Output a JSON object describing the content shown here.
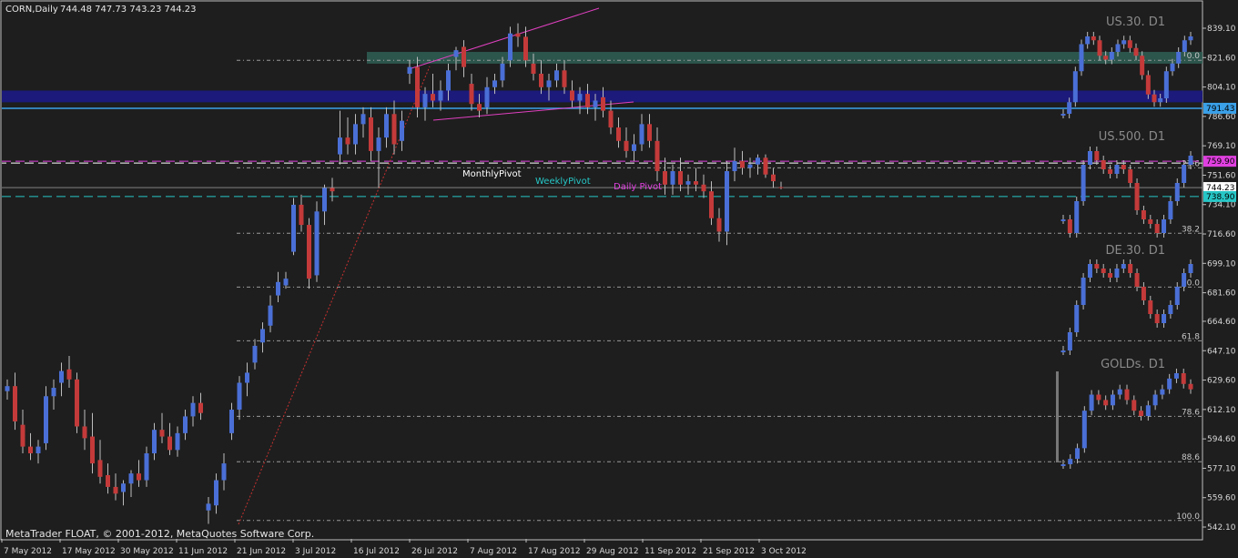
{
  "header": {
    "symbol_label": "CORN,Daily",
    "ohlc_text": "744.48 747.73 743.23 744.23"
  },
  "footer": {
    "copyright": "MetaTrader FLOAT, © 2001-2012, MetaQuotes Software Corp."
  },
  "colors": {
    "background": "#1e1e1e",
    "bull_candle": "#4a6fd6",
    "bear_candle": "#c43a3a",
    "fib_band": "#2f5f55",
    "blue_band": "#1c1a7a",
    "monthly_pivot": "#ffffff",
    "weekly_pivot": "#27c6c6",
    "daily_pivot": "#e040e0",
    "resistance_line": "#3aa0e8"
  },
  "chart_data": {
    "type": "candlestick",
    "symbol": "CORN",
    "timeframe": "Daily",
    "ylim": [
      542.1,
      850
    ],
    "y_ticks": [
      "839.10",
      "821.60",
      "804.10",
      "786.60",
      "769.10",
      "751.60",
      "734.10",
      "716.60",
      "699.10",
      "681.60",
      "664.60",
      "647.10",
      "629.60",
      "612.10",
      "594.60",
      "577.10",
      "559.60",
      "542.10"
    ],
    "x_ticks": [
      "7 May 2012",
      "17 May 2012",
      "30 May 2012",
      "11 Jun 2012",
      "21 Jun 2012",
      "3 Jul 2012",
      "16 Jul 2012",
      "26 Jul 2012",
      "7 Aug 2012",
      "17 Aug 2012",
      "29 Aug 2012",
      "11 Sep 2012",
      "21 Sep 2012",
      "3 Oct 2012"
    ],
    "price_tags": [
      {
        "value": 791.43,
        "label": "791.43",
        "color": "#3aa0e8"
      },
      {
        "value": 759.9,
        "label": "759.90",
        "color": "#e040e0"
      },
      {
        "value": 744.23,
        "label": "744.23",
        "color": "#ffffff"
      },
      {
        "value": 738.9,
        "label": "738.90",
        "color": "#27c6c6"
      }
    ],
    "fib_levels": [
      {
        "label": "0.0",
        "value": 820
      },
      {
        "label": "23.6",
        "value": 756
      },
      {
        "label": "38.2",
        "value": 717
      },
      {
        "label": "50.0",
        "value": 685
      },
      {
        "label": "61.8",
        "value": 653
      },
      {
        "label": "78.6",
        "value": 608
      },
      {
        "label": "88.6",
        "value": 581
      },
      {
        "label": "100.0",
        "value": 546
      }
    ],
    "pivots": [
      {
        "name": "MonthlyPivot",
        "value": 759.9
      },
      {
        "name": "WeeklyPivot",
        "value": 738.9
      },
      {
        "name": "Daily Pivot",
        "value": 759.9
      }
    ],
    "bands": [
      {
        "name": "fib_zone",
        "from": 818,
        "to": 825
      },
      {
        "name": "blue_zone",
        "from": 795,
        "to": 802
      }
    ],
    "candles": [
      {
        "o": 623,
        "h": 630,
        "l": 618,
        "c": 626
      },
      {
        "o": 626,
        "h": 634,
        "l": 600,
        "c": 605
      },
      {
        "o": 603,
        "h": 612,
        "l": 586,
        "c": 590
      },
      {
        "o": 590,
        "h": 598,
        "l": 582,
        "c": 586
      },
      {
        "o": 586,
        "h": 594,
        "l": 580,
        "c": 590
      },
      {
        "o": 592,
        "h": 626,
        "l": 588,
        "c": 620
      },
      {
        "o": 620,
        "h": 630,
        "l": 612,
        "c": 625
      },
      {
        "o": 628,
        "h": 640,
        "l": 620,
        "c": 635
      },
      {
        "o": 636,
        "h": 644,
        "l": 625,
        "c": 630
      },
      {
        "o": 630,
        "h": 634,
        "l": 598,
        "c": 602
      },
      {
        "o": 602,
        "h": 612,
        "l": 588,
        "c": 595
      },
      {
        "o": 596,
        "h": 610,
        "l": 574,
        "c": 580
      },
      {
        "o": 582,
        "h": 594,
        "l": 568,
        "c": 572
      },
      {
        "o": 573,
        "h": 580,
        "l": 562,
        "c": 566
      },
      {
        "o": 566,
        "h": 574,
        "l": 558,
        "c": 562
      },
      {
        "o": 563,
        "h": 570,
        "l": 555,
        "c": 568
      },
      {
        "o": 568,
        "h": 576,
        "l": 560,
        "c": 574
      },
      {
        "o": 574,
        "h": 582,
        "l": 566,
        "c": 570
      },
      {
        "o": 570,
        "h": 590,
        "l": 566,
        "c": 586
      },
      {
        "o": 586,
        "h": 604,
        "l": 582,
        "c": 600
      },
      {
        "o": 600,
        "h": 610,
        "l": 592,
        "c": 596
      },
      {
        "o": 596,
        "h": 604,
        "l": 585,
        "c": 588
      },
      {
        "o": 588,
        "h": 602,
        "l": 584,
        "c": 598
      },
      {
        "o": 598,
        "h": 612,
        "l": 594,
        "c": 608
      },
      {
        "o": 608,
        "h": 620,
        "l": 602,
        "c": 616
      },
      {
        "o": 616,
        "h": 622,
        "l": 606,
        "c": 610
      },
      {
        "o": 552,
        "h": 560,
        "l": 544,
        "c": 556
      },
      {
        "o": 555,
        "h": 574,
        "l": 550,
        "c": 570
      },
      {
        "o": 570,
        "h": 586,
        "l": 564,
        "c": 580
      },
      {
        "o": 598,
        "h": 616,
        "l": 594,
        "c": 612
      },
      {
        "o": 612,
        "h": 632,
        "l": 606,
        "c": 628
      },
      {
        "o": 628,
        "h": 640,
        "l": 620,
        "c": 634
      },
      {
        "o": 640,
        "h": 654,
        "l": 636,
        "c": 650
      },
      {
        "o": 652,
        "h": 664,
        "l": 646,
        "c": 660
      },
      {
        "o": 662,
        "h": 680,
        "l": 658,
        "c": 674
      },
      {
        "o": 680,
        "h": 694,
        "l": 676,
        "c": 688
      },
      {
        "o": 686,
        "h": 694,
        "l": 684,
        "c": 690
      },
      {
        "o": 706,
        "h": 738,
        "l": 704,
        "c": 734
      },
      {
        "o": 734,
        "h": 740,
        "l": 718,
        "c": 722
      },
      {
        "o": 722,
        "h": 726,
        "l": 684,
        "c": 690
      },
      {
        "o": 692,
        "h": 736,
        "l": 688,
        "c": 730
      },
      {
        "o": 730,
        "h": 746,
        "l": 722,
        "c": 744
      },
      {
        "o": 744,
        "h": 750,
        "l": 736,
        "c": 742
      },
      {
        "o": 764,
        "h": 790,
        "l": 758,
        "c": 774
      },
      {
        "o": 774,
        "h": 786,
        "l": 764,
        "c": 770
      },
      {
        "o": 770,
        "h": 788,
        "l": 764,
        "c": 782
      },
      {
        "o": 782,
        "h": 792,
        "l": 774,
        "c": 788
      },
      {
        "o": 786,
        "h": 792,
        "l": 760,
        "c": 766
      },
      {
        "o": 766,
        "h": 780,
        "l": 744,
        "c": 774
      },
      {
        "o": 774,
        "h": 792,
        "l": 768,
        "c": 788
      },
      {
        "o": 788,
        "h": 796,
        "l": 764,
        "c": 770
      },
      {
        "o": 772,
        "h": 790,
        "l": 766,
        "c": 784
      },
      {
        "o": 812,
        "h": 820,
        "l": 806,
        "c": 816
      },
      {
        "o": 816,
        "h": 822,
        "l": 786,
        "c": 792
      },
      {
        "o": 792,
        "h": 804,
        "l": 784,
        "c": 800
      },
      {
        "o": 800,
        "h": 812,
        "l": 792,
        "c": 796
      },
      {
        "o": 796,
        "h": 808,
        "l": 790,
        "c": 802
      },
      {
        "o": 802,
        "h": 818,
        "l": 796,
        "c": 814
      },
      {
        "o": 822,
        "h": 828,
        "l": 814,
        "c": 826
      },
      {
        "o": 828,
        "h": 832,
        "l": 810,
        "c": 816
      },
      {
        "o": 806,
        "h": 812,
        "l": 790,
        "c": 794
      },
      {
        "o": 794,
        "h": 800,
        "l": 786,
        "c": 790
      },
      {
        "o": 792,
        "h": 810,
        "l": 788,
        "c": 804
      },
      {
        "o": 804,
        "h": 812,
        "l": 800,
        "c": 808
      },
      {
        "o": 808,
        "h": 822,
        "l": 804,
        "c": 818
      },
      {
        "o": 820,
        "h": 840,
        "l": 816,
        "c": 836
      },
      {
        "o": 836,
        "h": 842,
        "l": 828,
        "c": 834
      },
      {
        "o": 834,
        "h": 840,
        "l": 816,
        "c": 820
      },
      {
        "o": 818,
        "h": 824,
        "l": 808,
        "c": 812
      },
      {
        "o": 812,
        "h": 820,
        "l": 800,
        "c": 804
      },
      {
        "o": 804,
        "h": 812,
        "l": 796,
        "c": 808
      },
      {
        "o": 808,
        "h": 818,
        "l": 804,
        "c": 814
      },
      {
        "o": 814,
        "h": 820,
        "l": 800,
        "c": 804
      },
      {
        "o": 802,
        "h": 808,
        "l": 792,
        "c": 796
      },
      {
        "o": 796,
        "h": 804,
        "l": 788,
        "c": 800
      },
      {
        "o": 800,
        "h": 806,
        "l": 788,
        "c": 792
      },
      {
        "o": 792,
        "h": 800,
        "l": 784,
        "c": 796
      },
      {
        "o": 798,
        "h": 804,
        "l": 786,
        "c": 790
      },
      {
        "o": 790,
        "h": 796,
        "l": 776,
        "c": 780
      },
      {
        "o": 780,
        "h": 786,
        "l": 768,
        "c": 772
      },
      {
        "o": 772,
        "h": 780,
        "l": 762,
        "c": 766
      },
      {
        "o": 766,
        "h": 776,
        "l": 760,
        "c": 770
      },
      {
        "o": 770,
        "h": 788,
        "l": 766,
        "c": 782
      },
      {
        "o": 782,
        "h": 788,
        "l": 768,
        "c": 772
      },
      {
        "o": 772,
        "h": 780,
        "l": 748,
        "c": 754
      },
      {
        "o": 754,
        "h": 762,
        "l": 740,
        "c": 746
      },
      {
        "o": 746,
        "h": 758,
        "l": 740,
        "c": 754
      },
      {
        "o": 754,
        "h": 762,
        "l": 742,
        "c": 746
      },
      {
        "o": 746,
        "h": 752,
        "l": 740,
        "c": 748
      },
      {
        "o": 748,
        "h": 756,
        "l": 742,
        "c": 746
      },
      {
        "o": 746,
        "h": 752,
        "l": 738,
        "c": 742
      },
      {
        "o": 742,
        "h": 748,
        "l": 722,
        "c": 726
      },
      {
        "o": 726,
        "h": 732,
        "l": 712,
        "c": 718
      },
      {
        "o": 718,
        "h": 760,
        "l": 710,
        "c": 754
      },
      {
        "o": 754,
        "h": 768,
        "l": 748,
        "c": 760
      },
      {
        "o": 760,
        "h": 766,
        "l": 752,
        "c": 756
      },
      {
        "o": 756,
        "h": 762,
        "l": 750,
        "c": 758
      },
      {
        "o": 758,
        "h": 764,
        "l": 752,
        "c": 762
      },
      {
        "o": 762,
        "h": 764,
        "l": 750,
        "c": 752
      },
      {
        "o": 752,
        "h": 756,
        "l": 744,
        "c": 748
      },
      {
        "o": 744.48,
        "h": 747.73,
        "l": 743.23,
        "c": 744.23
      }
    ],
    "labels": [
      {
        "text": "MonthlyPivot",
        "kind": "monthly"
      },
      {
        "text": "WeeklyPivot",
        "kind": "weekly"
      },
      {
        "text": "Daily Pivot",
        "kind": "daily"
      }
    ],
    "mini_charts": [
      {
        "title": "US.30. D1",
        "values": [
          790,
          796,
          812,
          826,
          830,
          828,
          820,
          818,
          822,
          826,
          828,
          824,
          820,
          810,
          800,
          796,
          798,
          812,
          816,
          822,
          828,
          830
        ]
      },
      {
        "title": "US.500. D1",
        "values": [
          736,
          730,
          744,
          760,
          766,
          762,
          758,
          756,
          760,
          758,
          752,
          740,
          736,
          734,
          730,
          736,
          744,
          752,
          760,
          764
        ]
      },
      {
        "title": "DE.30. D1",
        "values": [
          652,
          660,
          672,
          684,
          690,
          688,
          686,
          684,
          688,
          690,
          686,
          680,
          674,
          668,
          664,
          668,
          672,
          680,
          686,
          690
        ]
      },
      {
        "title": "GOLDs. D1",
        "values": [
          598,
          600,
          604,
          618,
          624,
          622,
          620,
          624,
          626,
          622,
          618,
          616,
          620,
          624,
          626,
          630,
          632,
          628,
          626
        ]
      }
    ]
  }
}
